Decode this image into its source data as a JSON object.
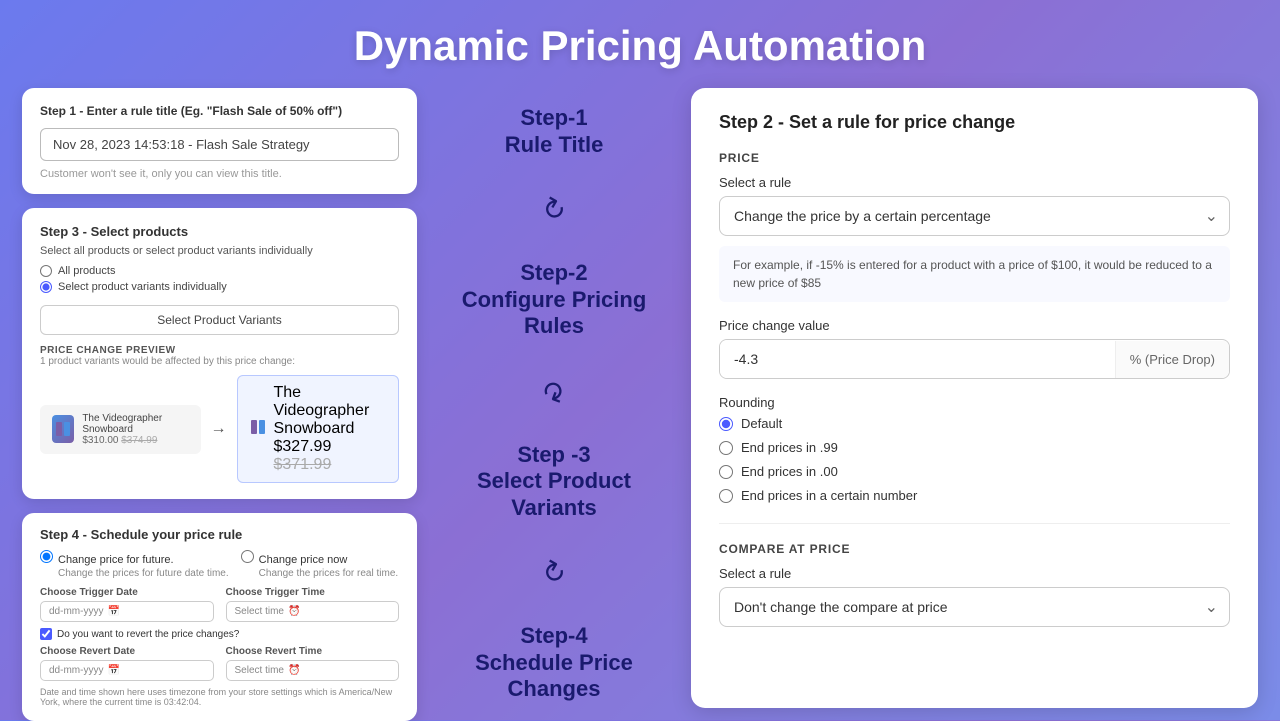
{
  "page": {
    "title": "Dynamic Pricing Automation"
  },
  "step1": {
    "heading": "Step 1 - Enter a rule title (Eg. \"Flash Sale of 50% off\")",
    "input_value": "Nov 28, 2023 14:53:18 - Flash Sale Strategy",
    "note": "Customer won't see it, only you can view this title.",
    "label": "Step-1",
    "sublabel": "Rule Title"
  },
  "step2": {
    "heading": "Step 2 - Set a rule for price change",
    "label": "Step-2",
    "sublabel": "Configure Pricing Rules",
    "price_section_title": "PRICE",
    "select_label": "Select a rule",
    "select_value": "Change the price by a certain percentage",
    "info_text": "For example, if -15% is entered for a product with a price of $100, it would be reduced to a new price of $85",
    "price_change_label": "Price change value",
    "price_change_value": "-4.3",
    "price_change_unit": "% (Price Drop)",
    "rounding_label": "Rounding",
    "rounding_options": [
      {
        "id": "default",
        "label": "Default",
        "checked": true
      },
      {
        "id": "end99",
        "label": "End prices in .99",
        "checked": false
      },
      {
        "id": "end00",
        "label": "End prices in .00",
        "checked": false
      },
      {
        "id": "certain",
        "label": "End prices in a certain number",
        "checked": false
      }
    ],
    "compare_section_title": "COMPARE AT PRICE",
    "compare_select_label": "Select a rule",
    "compare_select_value": "Don't change the compare at price"
  },
  "step3": {
    "heading": "Step 3 - Select products",
    "sub": "Select all products or select product variants individually",
    "radio1": "All products",
    "radio2": "Select product variants individually",
    "btn": "Select Product Variants",
    "preview_title": "PRICE CHANGE PREVIEW",
    "preview_sub": "1 product variants would be affected by this price change:",
    "product1_name": "The Videographer Snowboard",
    "product1_price": "$310.00",
    "product1_old_price": "$374.99",
    "product2_name": "The Videographer Snowboard",
    "product2_price": "$327.99",
    "product2_old_price": "$371.99",
    "label": "Step -3",
    "sublabel": "Select Product\nVariants"
  },
  "step4": {
    "heading": "Step 4 - Schedule your price rule",
    "option1_label": "Change price for future.",
    "option1_desc": "Change the prices for future date time.",
    "option2_label": "Change price now",
    "option2_desc": "Change the prices for real time.",
    "trigger_date_label": "Choose Trigger Date",
    "trigger_date_placeholder": "dd-mm-yyyy",
    "trigger_time_label": "Choose Trigger Time",
    "trigger_time_placeholder": "Select time",
    "checkbox_label": "Do you want to revert the price changes?",
    "revert_date_label": "Choose Revert Date",
    "revert_date_placeholder": "dd-mm-yyyy",
    "revert_time_label": "Choose Revert Time",
    "revert_time_placeholder": "Select time",
    "timezone_note": "Date and time shown here uses timezone from your store settings which is America/New York, where the current time is 03:42:04.",
    "label": "Step-4",
    "sublabel": "Schedule Price\nChanges"
  }
}
